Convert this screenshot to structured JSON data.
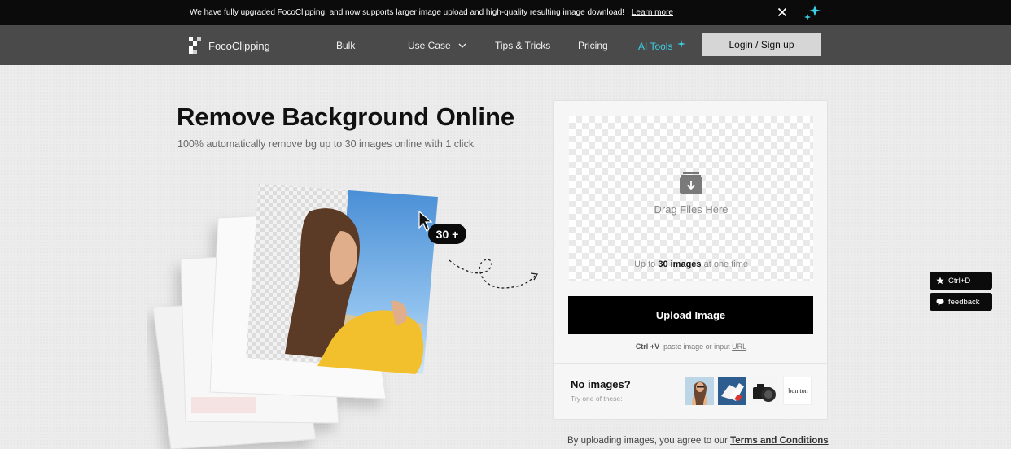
{
  "banner": {
    "text": "We have fully upgraded FocoClipping,  and now supports larger image upload and high-quality resulting image download!",
    "link": "Learn more",
    "close_icon": "close-icon",
    "sparkle_icon": "sparkle-icon"
  },
  "nav": {
    "logo_text": "FocoClipping",
    "items": [
      {
        "label": "Bulk"
      },
      {
        "label": "Use Case"
      },
      {
        "label": "Tips & Tricks"
      },
      {
        "label": "Pricing"
      }
    ],
    "ai_tools": "AI Tools",
    "login": "Login / Sign up"
  },
  "hero": {
    "title": "Remove Background Online",
    "subtitle": "100% automatically remove bg up to 30 images online with 1 click",
    "count_badge": "30 +"
  },
  "upload": {
    "drag_text": "Drag Files Here",
    "limit_prefix": "Up to",
    "limit_bold": "30 images",
    "limit_suffix": "at one time",
    "button": "Upload Image",
    "paste_key": "Ctrl +V",
    "paste_text": "paste image or input",
    "paste_url": "URL",
    "no_images": "No images?",
    "try_one": "Try one of these:",
    "samples": [
      "sample-woman",
      "sample-shoes",
      "sample-camera",
      "sample-logo"
    ],
    "sample_logo_text": "bon ton"
  },
  "terms": {
    "prefix": "By uploading images, you agree to our",
    "link": "Terms and Conditions"
  },
  "side": {
    "bookmark": "Ctrl+D",
    "feedback": "feedback"
  },
  "colors": {
    "banner_bg": "#0b0b0b",
    "nav_bg": "#4a4a4a",
    "accent_ai": "#3ad0e6",
    "upload_button": "#000000"
  }
}
